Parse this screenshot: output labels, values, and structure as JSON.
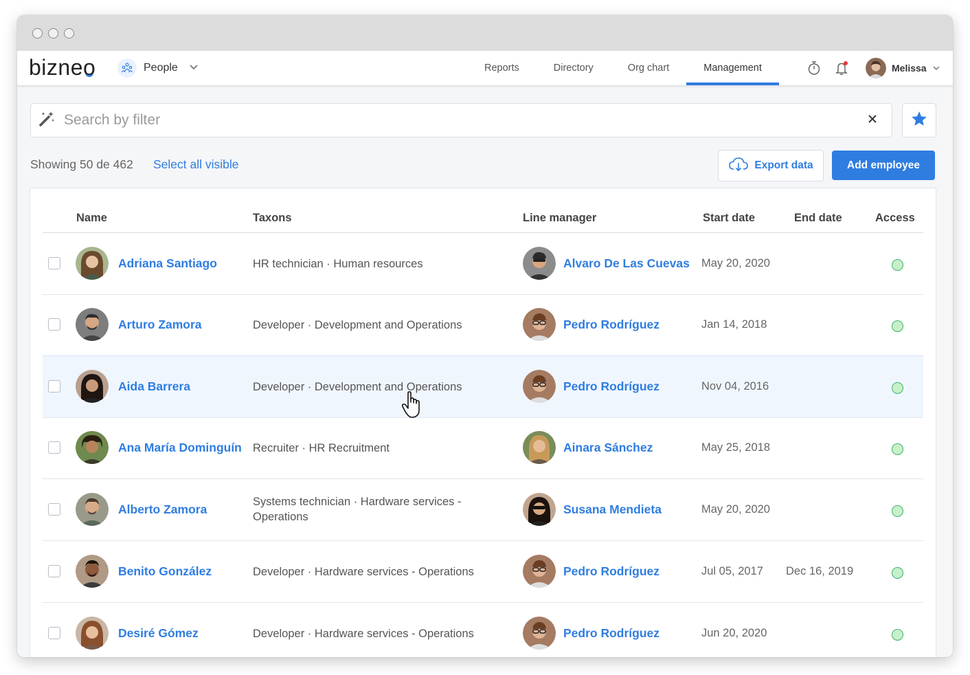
{
  "app": {
    "logo": "bizneo",
    "module_label": "People"
  },
  "nav": {
    "tabs": [
      {
        "label": "Reports"
      },
      {
        "label": "Directory"
      },
      {
        "label": "Org chart"
      },
      {
        "label": "Management",
        "active": true
      }
    ],
    "user_name": "Melissa"
  },
  "search": {
    "placeholder": "Search by filter"
  },
  "summary": {
    "showing": "Showing 50 de 462",
    "select_all": "Select all visible"
  },
  "actions": {
    "export": "Export data",
    "add": "Add employee"
  },
  "colors": {
    "accent": "#2f7de1",
    "access_active": "#3cb371"
  },
  "table": {
    "columns": {
      "name": "Name",
      "taxons": "Taxons",
      "line_manager": "Line manager",
      "start_date": "Start date",
      "end_date": "End date",
      "access": "Access"
    },
    "rows": [
      {
        "name": "Adriana Santiago",
        "taxons": "HR technician · Human resources",
        "manager": "Alvaro De Las Cuevas",
        "start": "May 20, 2020",
        "end": "",
        "access": "active"
      },
      {
        "name": "Arturo Zamora",
        "taxons": "Developer · Development and Operations",
        "manager": "Pedro Rodríguez",
        "start": "Jan 14, 2018",
        "end": "",
        "access": "active"
      },
      {
        "name": "Aida Barrera",
        "taxons": "Developer · Development and Operations",
        "manager": "Pedro Rodríguez",
        "start": "Nov 04, 2016",
        "end": "",
        "access": "active"
      },
      {
        "name": "Ana María Dominguín",
        "taxons": "Recruiter · HR Recruitment",
        "manager": "Ainara Sánchez",
        "start": "May 25, 2018",
        "end": "",
        "access": "active"
      },
      {
        "name": "Alberto Zamora",
        "taxons": "Systems technician · Hardware services - Operations",
        "manager": "Susana Mendieta",
        "start": "May 20, 2020",
        "end": "",
        "access": "active"
      },
      {
        "name": "Benito González",
        "taxons": "Developer · Hardware services - Operations",
        "manager": "Pedro Rodríguez",
        "start": "Jul 05, 2017",
        "end": "Dec 16, 2019",
        "access": "active"
      },
      {
        "name": "Desiré Gómez",
        "taxons": "Developer · Hardware services - Operations",
        "manager": "Pedro Rodríguez",
        "start": "Jun 20, 2020",
        "end": "",
        "access": "active"
      }
    ]
  }
}
